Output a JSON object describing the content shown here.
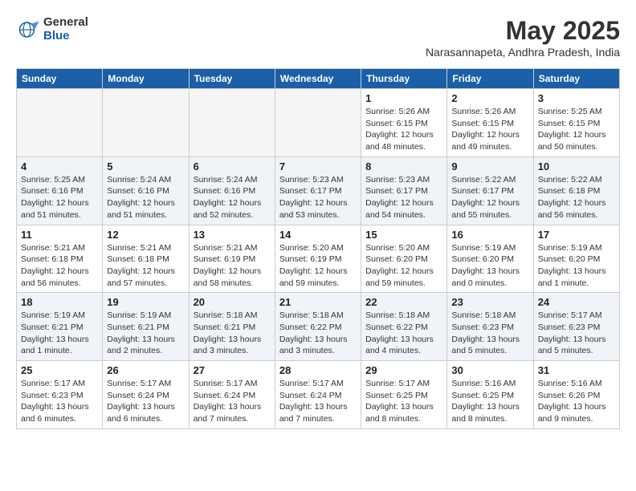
{
  "logo": {
    "general": "General",
    "blue": "Blue"
  },
  "title": "May 2025",
  "subtitle": "Narasannapeta, Andhra Pradesh, India",
  "days_of_week": [
    "Sunday",
    "Monday",
    "Tuesday",
    "Wednesday",
    "Thursday",
    "Friday",
    "Saturday"
  ],
  "weeks": [
    [
      {
        "day": "",
        "info": ""
      },
      {
        "day": "",
        "info": ""
      },
      {
        "day": "",
        "info": ""
      },
      {
        "day": "",
        "info": ""
      },
      {
        "day": "1",
        "info": "Sunrise: 5:26 AM\nSunset: 6:15 PM\nDaylight: 12 hours\nand 48 minutes."
      },
      {
        "day": "2",
        "info": "Sunrise: 5:26 AM\nSunset: 6:15 PM\nDaylight: 12 hours\nand 49 minutes."
      },
      {
        "day": "3",
        "info": "Sunrise: 5:25 AM\nSunset: 6:15 PM\nDaylight: 12 hours\nand 50 minutes."
      }
    ],
    [
      {
        "day": "4",
        "info": "Sunrise: 5:25 AM\nSunset: 6:16 PM\nDaylight: 12 hours\nand 51 minutes."
      },
      {
        "day": "5",
        "info": "Sunrise: 5:24 AM\nSunset: 6:16 PM\nDaylight: 12 hours\nand 51 minutes."
      },
      {
        "day": "6",
        "info": "Sunrise: 5:24 AM\nSunset: 6:16 PM\nDaylight: 12 hours\nand 52 minutes."
      },
      {
        "day": "7",
        "info": "Sunrise: 5:23 AM\nSunset: 6:17 PM\nDaylight: 12 hours\nand 53 minutes."
      },
      {
        "day": "8",
        "info": "Sunrise: 5:23 AM\nSunset: 6:17 PM\nDaylight: 12 hours\nand 54 minutes."
      },
      {
        "day": "9",
        "info": "Sunrise: 5:22 AM\nSunset: 6:17 PM\nDaylight: 12 hours\nand 55 minutes."
      },
      {
        "day": "10",
        "info": "Sunrise: 5:22 AM\nSunset: 6:18 PM\nDaylight: 12 hours\nand 56 minutes."
      }
    ],
    [
      {
        "day": "11",
        "info": "Sunrise: 5:21 AM\nSunset: 6:18 PM\nDaylight: 12 hours\nand 56 minutes."
      },
      {
        "day": "12",
        "info": "Sunrise: 5:21 AM\nSunset: 6:18 PM\nDaylight: 12 hours\nand 57 minutes."
      },
      {
        "day": "13",
        "info": "Sunrise: 5:21 AM\nSunset: 6:19 PM\nDaylight: 12 hours\nand 58 minutes."
      },
      {
        "day": "14",
        "info": "Sunrise: 5:20 AM\nSunset: 6:19 PM\nDaylight: 12 hours\nand 59 minutes."
      },
      {
        "day": "15",
        "info": "Sunrise: 5:20 AM\nSunset: 6:20 PM\nDaylight: 12 hours\nand 59 minutes."
      },
      {
        "day": "16",
        "info": "Sunrise: 5:19 AM\nSunset: 6:20 PM\nDaylight: 13 hours\nand 0 minutes."
      },
      {
        "day": "17",
        "info": "Sunrise: 5:19 AM\nSunset: 6:20 PM\nDaylight: 13 hours\nand 1 minute."
      }
    ],
    [
      {
        "day": "18",
        "info": "Sunrise: 5:19 AM\nSunset: 6:21 PM\nDaylight: 13 hours\nand 1 minute."
      },
      {
        "day": "19",
        "info": "Sunrise: 5:19 AM\nSunset: 6:21 PM\nDaylight: 13 hours\nand 2 minutes."
      },
      {
        "day": "20",
        "info": "Sunrise: 5:18 AM\nSunset: 6:21 PM\nDaylight: 13 hours\nand 3 minutes."
      },
      {
        "day": "21",
        "info": "Sunrise: 5:18 AM\nSunset: 6:22 PM\nDaylight: 13 hours\nand 3 minutes."
      },
      {
        "day": "22",
        "info": "Sunrise: 5:18 AM\nSunset: 6:22 PM\nDaylight: 13 hours\nand 4 minutes."
      },
      {
        "day": "23",
        "info": "Sunrise: 5:18 AM\nSunset: 6:23 PM\nDaylight: 13 hours\nand 5 minutes."
      },
      {
        "day": "24",
        "info": "Sunrise: 5:17 AM\nSunset: 6:23 PM\nDaylight: 13 hours\nand 5 minutes."
      }
    ],
    [
      {
        "day": "25",
        "info": "Sunrise: 5:17 AM\nSunset: 6:23 PM\nDaylight: 13 hours\nand 6 minutes."
      },
      {
        "day": "26",
        "info": "Sunrise: 5:17 AM\nSunset: 6:24 PM\nDaylight: 13 hours\nand 6 minutes."
      },
      {
        "day": "27",
        "info": "Sunrise: 5:17 AM\nSunset: 6:24 PM\nDaylight: 13 hours\nand 7 minutes."
      },
      {
        "day": "28",
        "info": "Sunrise: 5:17 AM\nSunset: 6:24 PM\nDaylight: 13 hours\nand 7 minutes."
      },
      {
        "day": "29",
        "info": "Sunrise: 5:17 AM\nSunset: 6:25 PM\nDaylight: 13 hours\nand 8 minutes."
      },
      {
        "day": "30",
        "info": "Sunrise: 5:16 AM\nSunset: 6:25 PM\nDaylight: 13 hours\nand 8 minutes."
      },
      {
        "day": "31",
        "info": "Sunrise: 5:16 AM\nSunset: 6:26 PM\nDaylight: 13 hours\nand 9 minutes."
      }
    ]
  ]
}
